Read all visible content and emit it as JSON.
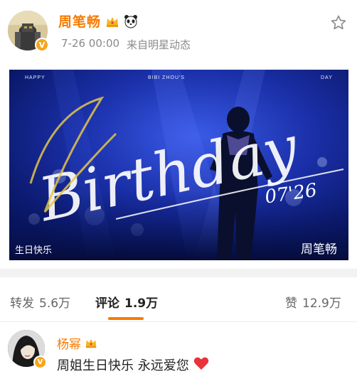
{
  "post": {
    "author_name": "周笔畅",
    "timestamp": "7-26 00:00",
    "source": "来自明星动态",
    "verified_badge": "V",
    "icons": [
      "crown-icon",
      "panda-icon",
      "star-icon"
    ],
    "image": {
      "top_left_text": "HAPPY",
      "top_center_text": "BIBI ZHOU'S",
      "top_right_text": "DAY",
      "script_text": "Birthday",
      "date_text": "07'26",
      "bottom_left_text": "生日快乐",
      "bottom_right_text": "周笔畅"
    }
  },
  "actions": {
    "repost_label": "转发",
    "repost_count": "5.6万",
    "comment_label": "评论",
    "comment_count": "1.9万",
    "like_label": "赞",
    "like_count": "12.9万"
  },
  "comment": {
    "author_name": "杨幂",
    "verified_badge": "V",
    "text": "周姐生日快乐 永远爱您",
    "emoji": "heart-icon"
  },
  "colors": {
    "accent": "#f77b00",
    "image_blue": "#0b1e7a",
    "heart": "#e8323c"
  }
}
